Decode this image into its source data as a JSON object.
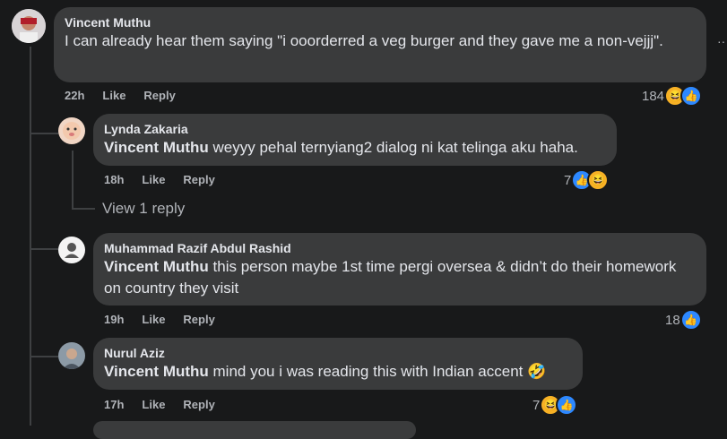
{
  "comments": [
    {
      "author": "Vincent Muthu",
      "text": "I can already hear them saying \"i ooorderred a veg burger and they gave me a non-vejjj\".",
      "time": "22h",
      "like": "Like",
      "reply": "Reply",
      "reaction_count": "184"
    },
    {
      "author": "Lynda Zakaria",
      "mention": "Vincent Muthu",
      "text": " weyyy pehal ternyiang2 dialog ni kat telinga aku haha.",
      "time": "18h",
      "like": "Like",
      "reply": "Reply",
      "reaction_count": "7",
      "view_replies": "View 1 reply"
    },
    {
      "author": "Muhammad Razif Abdul Rashid",
      "mention": "Vincent Muthu",
      "text": " this person maybe 1st time pergi oversea & didn’t do their homework on country they visit",
      "time": "19h",
      "like": "Like",
      "reply": "Reply",
      "reaction_count": "18"
    },
    {
      "author": "Nurul Aziz",
      "mention": "Vincent Muthu",
      "text": " mind you i was reading this with Indian accent 🤣",
      "time": "17h",
      "like": "Like",
      "reply": "Reply",
      "reaction_count": "7"
    }
  ],
  "icons": {
    "like": "👍",
    "haha": "😆",
    "more": "···"
  },
  "colors": {
    "background": "#18191a",
    "bubble": "#3a3b3c",
    "like_blue": "#2d88ff",
    "haha_yellow": "#f7b125"
  }
}
